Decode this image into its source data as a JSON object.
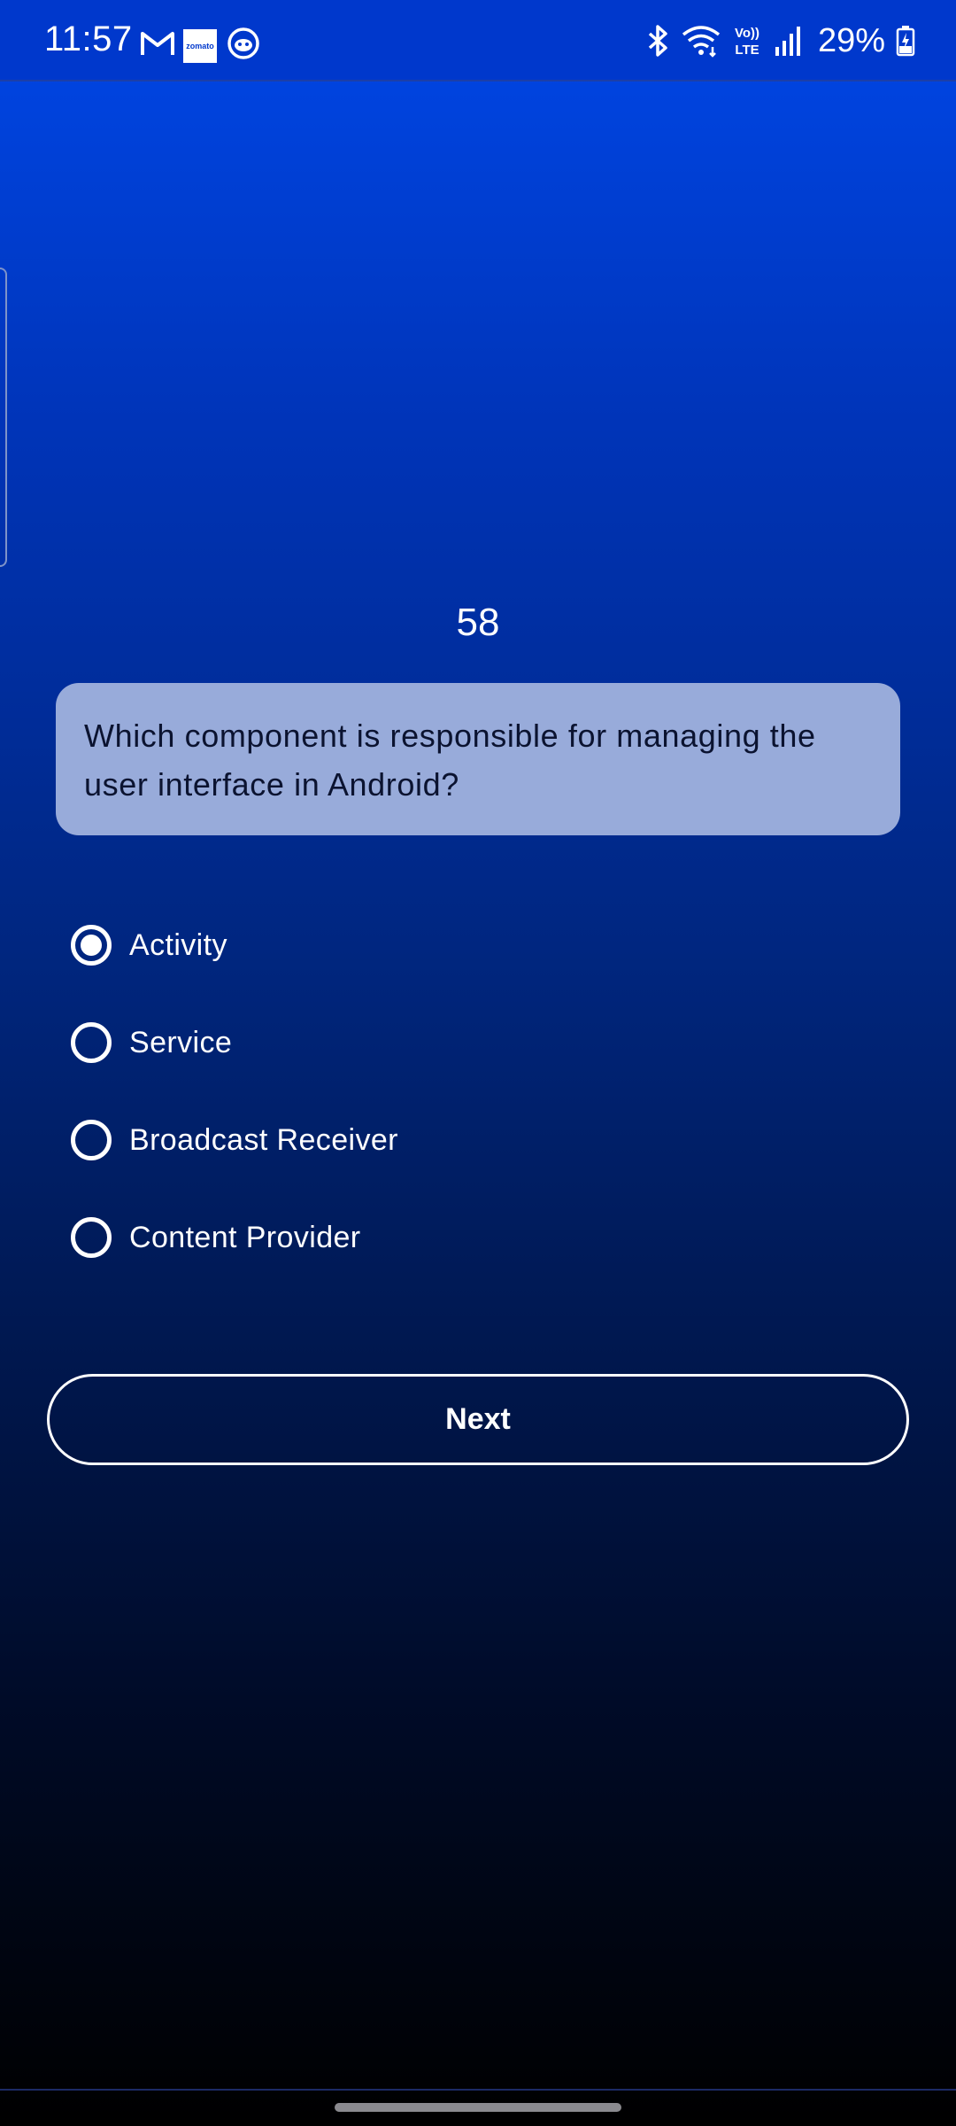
{
  "status_bar": {
    "time": "11:57",
    "battery": "29%",
    "notification_icons": [
      "gmail-icon",
      "zomato-icon",
      "bot-icon"
    ],
    "system_icons": [
      "bluetooth-icon",
      "wifi-icon",
      "volte-icon",
      "signal-icon",
      "battery-charging-icon"
    ],
    "volte_label_top": "Vo))",
    "volte_label_bottom": "LTE",
    "zomato_label": "zomato"
  },
  "quiz": {
    "question_number": "58",
    "question_text": "Which component is responsible for managing the user interface in Android?",
    "options": [
      {
        "label": "Activity",
        "selected": true
      },
      {
        "label": "Service",
        "selected": false
      },
      {
        "label": "Broadcast Receiver",
        "selected": false
      },
      {
        "label": "Content Provider",
        "selected": false
      }
    ],
    "next_label": "Next"
  },
  "colors": {
    "gradient_top": "#0047e8",
    "gradient_bottom": "#000000",
    "card_background": "#98abda",
    "status_bar": "#0038cc"
  }
}
